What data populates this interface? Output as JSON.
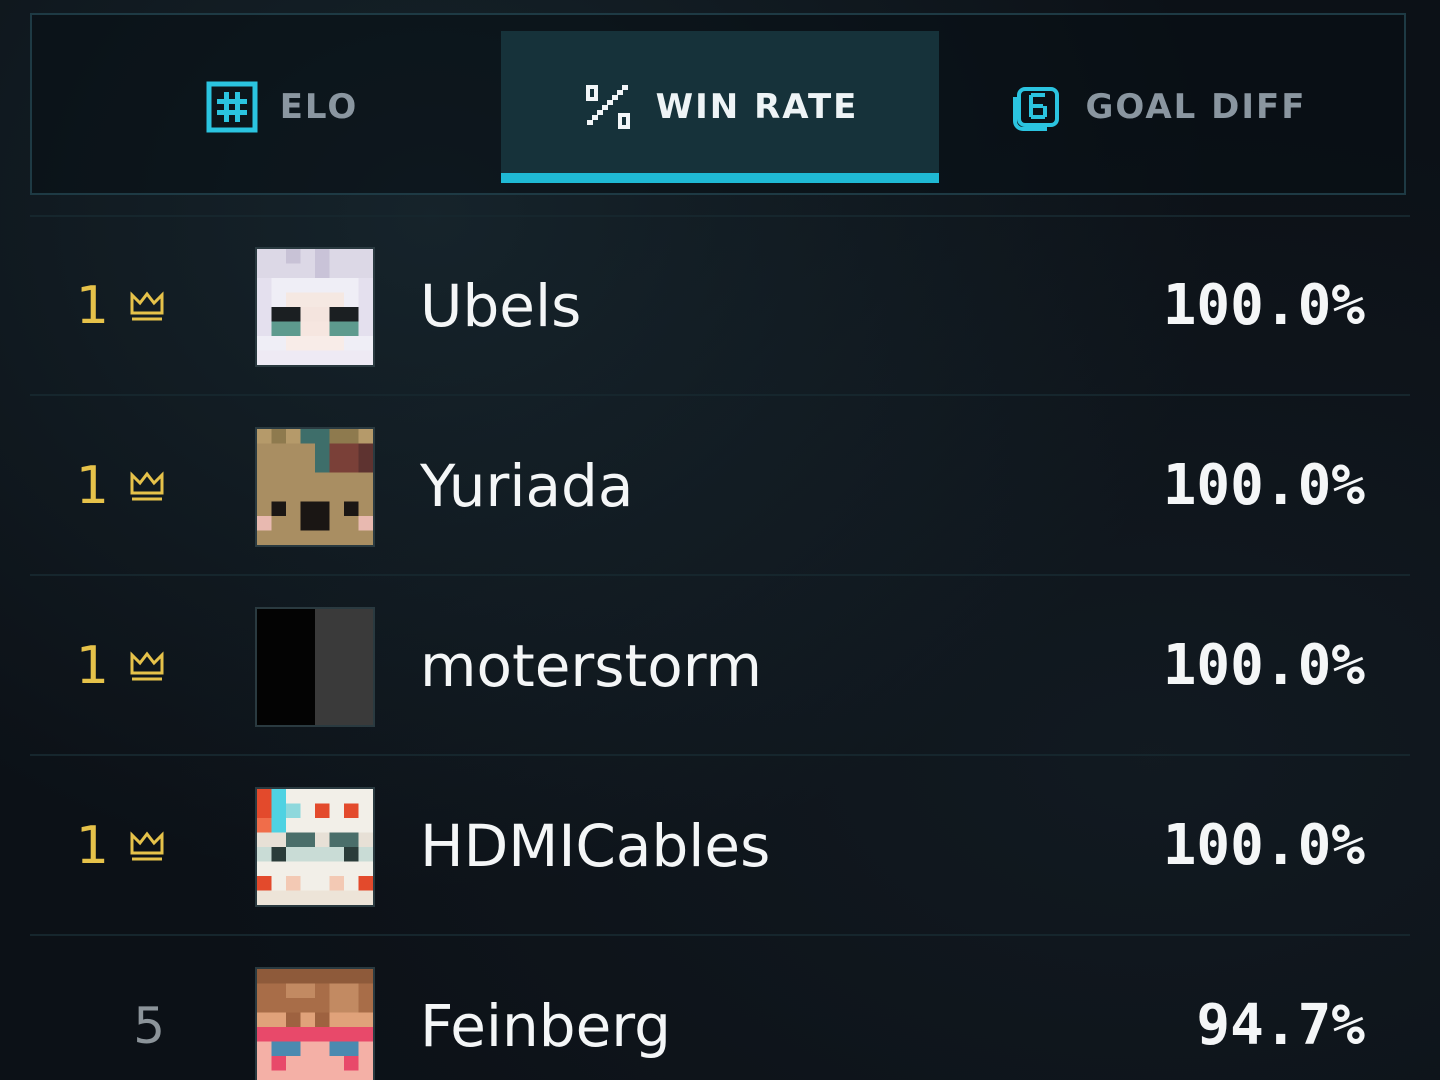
{
  "tabs": [
    {
      "label": "ELO",
      "icon": "hash-icon",
      "active": false
    },
    {
      "label": "WIN RATE",
      "icon": "percent-icon",
      "active": true
    },
    {
      "label": "GOAL DIFF",
      "icon": "goal-diff-icon",
      "active": false
    }
  ],
  "colors": {
    "accent": "#1fb9d4",
    "rank_gold": "#e6c24a",
    "rank_plain": "#8c949a",
    "active_tab_bg": "#16323a"
  },
  "leaderboard": {
    "rows": [
      {
        "rank": "1",
        "crown": true,
        "name": "Ubels",
        "value": "100.0%"
      },
      {
        "rank": "1",
        "crown": true,
        "name": "Yuriada",
        "value": "100.0%"
      },
      {
        "rank": "1",
        "crown": true,
        "name": "moterstorm",
        "value": "100.0%"
      },
      {
        "rank": "1",
        "crown": true,
        "name": "HDMICables",
        "value": "100.0%"
      },
      {
        "rank": "5",
        "crown": false,
        "name": "Feinberg",
        "value": "94.7%"
      }
    ]
  }
}
